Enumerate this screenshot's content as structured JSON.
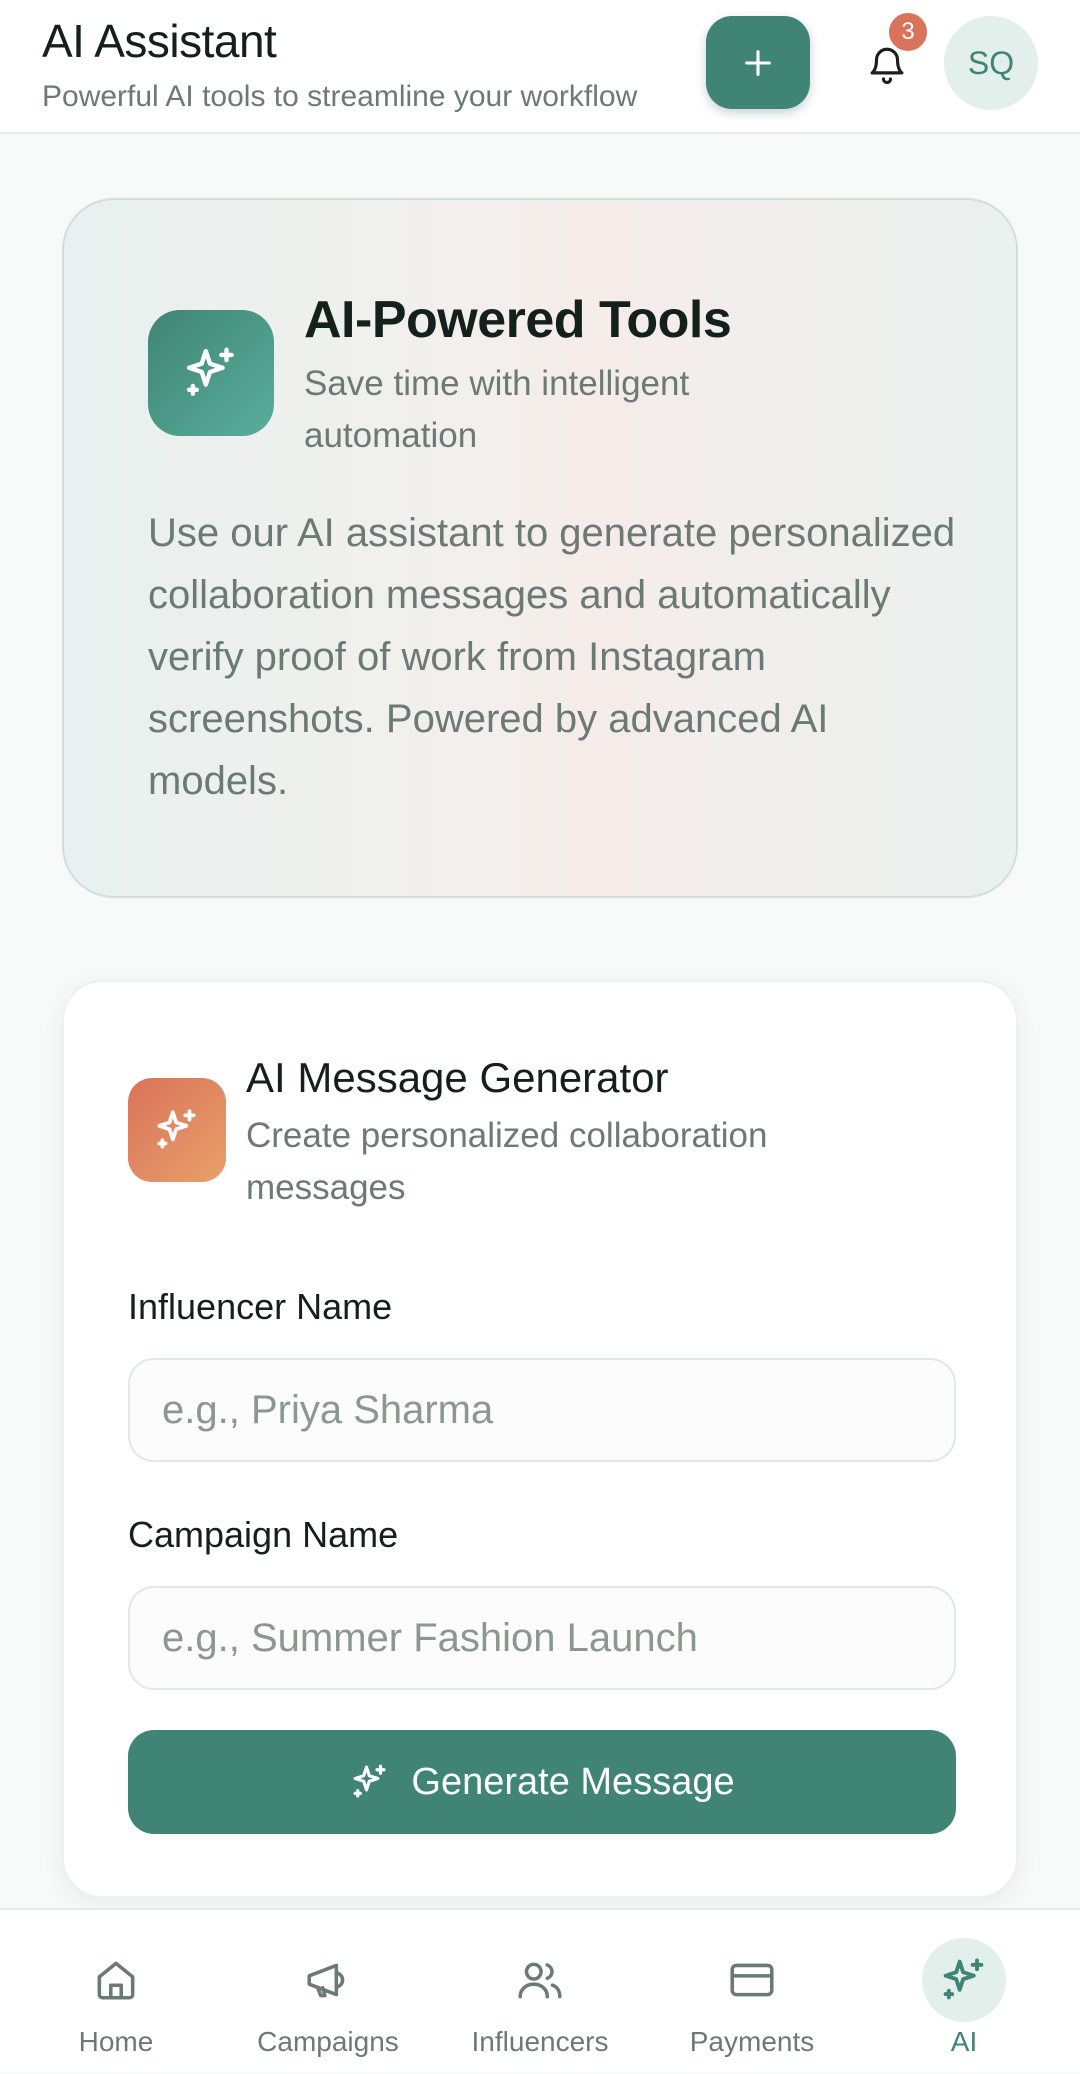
{
  "header": {
    "title": "AI Assistant",
    "subtitle": "Powerful AI tools to streamline your workflow",
    "notification_count": "3",
    "avatar_initials": "SQ",
    "add_icon": "plus-icon",
    "bell_icon": "bell-icon"
  },
  "hero": {
    "title": "AI-Powered Tools",
    "subtitle": "Save time with intelligent automation",
    "description": "Use our AI assistant to generate personalized collaboration messages and automatically verify proof of work from Instagram screenshots. Powered by advanced AI models.",
    "icon": "sparkles-icon"
  },
  "generator": {
    "title": "AI Message Generator",
    "subtitle": "Create personalized collaboration messages",
    "icon": "sparkles-icon",
    "influencer_label": "Influencer Name",
    "influencer_placeholder": "e.g., Priya Sharma",
    "influencer_value": "",
    "campaign_label": "Campaign Name",
    "campaign_placeholder": "e.g., Summer Fashion Launch",
    "campaign_value": "",
    "button_label": "Generate Message"
  },
  "nav": {
    "items": [
      {
        "label": "Home",
        "icon": "home-icon"
      },
      {
        "label": "Campaigns",
        "icon": "megaphone-icon"
      },
      {
        "label": "Influencers",
        "icon": "users-icon"
      },
      {
        "label": "Payments",
        "icon": "credit-card-icon"
      },
      {
        "label": "AI",
        "icon": "sparkles-icon"
      }
    ],
    "active": "AI"
  },
  "colors": {
    "primary": "#3f8474",
    "accent": "#d9735a",
    "text": "#14201b",
    "muted": "#6b7a74"
  }
}
